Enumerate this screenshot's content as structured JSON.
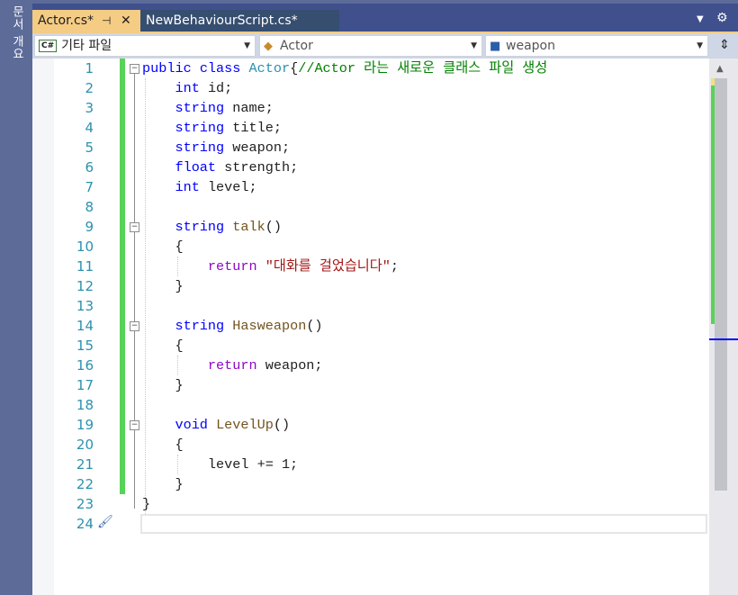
{
  "side_panel": {
    "label": "문서 개요"
  },
  "tabs": [
    {
      "label": "Actor.cs*",
      "pin": "⊣",
      "close": "✕"
    },
    {
      "label": "NewBehaviourScript.cs*"
    }
  ],
  "nav": {
    "project": {
      "badge": "C#",
      "label": "기타 파일"
    },
    "class": {
      "label": "Actor"
    },
    "member": {
      "label": "weapon"
    }
  },
  "editor": {
    "lines": [
      {
        "n": "1"
      },
      {
        "n": "2"
      },
      {
        "n": "3"
      },
      {
        "n": "4"
      },
      {
        "n": "5"
      },
      {
        "n": "6"
      },
      {
        "n": "7"
      },
      {
        "n": "8"
      },
      {
        "n": "9"
      },
      {
        "n": "10"
      },
      {
        "n": "11"
      },
      {
        "n": "12"
      },
      {
        "n": "13"
      },
      {
        "n": "14"
      },
      {
        "n": "15"
      },
      {
        "n": "16"
      },
      {
        "n": "17"
      },
      {
        "n": "18"
      },
      {
        "n": "19"
      },
      {
        "n": "20"
      },
      {
        "n": "21"
      },
      {
        "n": "22"
      },
      {
        "n": "23"
      },
      {
        "n": "24"
      }
    ],
    "tokens": {
      "l1_public": "public",
      "l1_class": "class",
      "l1_name": "Actor",
      "l1_brace": "{",
      "l1_comment": "//Actor 라는 새로운 클래스 파일 생성",
      "l2_type": "int",
      "l2_name": "id;",
      "l3_type": "string",
      "l3_name": "name;",
      "l4_type": "string",
      "l4_name": "title;",
      "l5_type": "string",
      "l5_name": "weapon;",
      "l6_type": "float",
      "l6_name": "strength;",
      "l7_type": "int",
      "l7_name": "level;",
      "l9_type": "string",
      "l9_name": "talk",
      "l9_paren": "()",
      "l10": "{",
      "l11_return": "return",
      "l11_str": "\"대화를 걸었습니다\"",
      "l11_semi": ";",
      "l12": "}",
      "l14_type": "string",
      "l14_name": "Hasweapon",
      "l14_paren": "()",
      "l15": "{",
      "l16_return": "return",
      "l16_val": "weapon;",
      "l17": "}",
      "l19_type": "void",
      "l19_name": "LevelUp",
      "l19_paren": "()",
      "l20": "{",
      "l21": "level += 1;",
      "l22": "}",
      "l23": "}"
    }
  },
  "colors": {
    "keyword": "#0000ff",
    "type": "#2b91af",
    "comment": "#008000",
    "string": "#a31515",
    "control": "#8f08c4",
    "method": "#74531f",
    "change_bar": "#57d358",
    "active_tab": "#f5cc84"
  }
}
